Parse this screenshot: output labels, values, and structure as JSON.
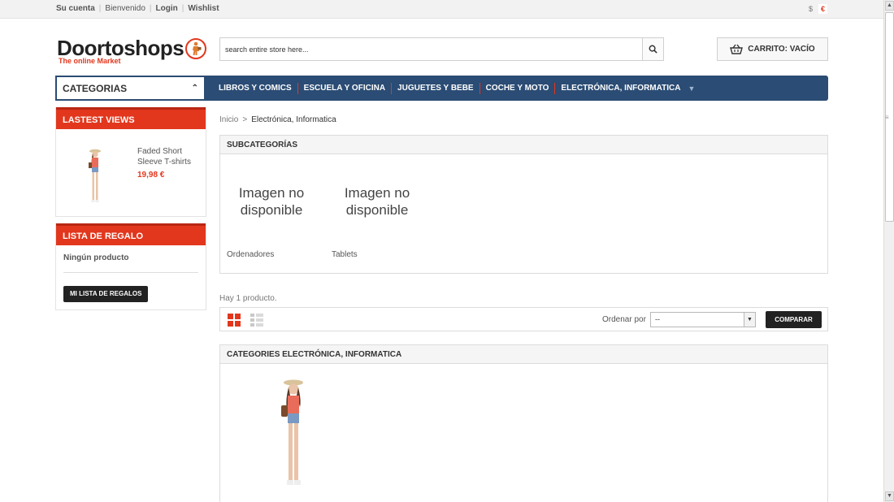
{
  "topbar": {
    "account": "Su cuenta",
    "welcome": "Bienvenido",
    "login": "Login",
    "wishlist": "Wishlist",
    "currencies": [
      "$",
      "€"
    ]
  },
  "logo": {
    "name": "Doortoshops",
    "tagline": "The online Market"
  },
  "search": {
    "placeholder": "search entire store here..."
  },
  "cart": {
    "label": "CARRITO: VACÍO"
  },
  "nav": {
    "categories_label": "CATEGORIAS",
    "items": [
      "LIBROS Y COMICS",
      "ESCUELA Y OFICINA",
      "JUGUETES Y BEBE",
      "COCHE Y MOTO",
      "ELECTRÓNICA, INFORMATICA"
    ]
  },
  "latest_views": {
    "title": "LASTEST VIEWS",
    "product_name": "Faded Short Sleeve T-shirts",
    "product_price": "19,98 €"
  },
  "gift_list": {
    "title": "LISTA DE REGALO",
    "empty": "Ningún producto",
    "button": "MI LISTA DE REGALOS"
  },
  "breadcrumb": {
    "home": "Inicio",
    "sep": ">",
    "current": "Electrónica, Informatica"
  },
  "subcategories": {
    "title": "SUBCATEGORÍAS",
    "items": [
      {
        "image_text": "Imagen no disponible",
        "name": "Ordenadores"
      },
      {
        "image_text": "Imagen no disponible",
        "name": "Tablets"
      }
    ]
  },
  "listing": {
    "count": "Hay 1 producto.",
    "sort_label": "Ordenar por",
    "sort_value": "--",
    "compare": "COMPARAR"
  },
  "category_panel": {
    "title": "CATEGORIES ELECTRÓNICA, INFORMATICA"
  },
  "colors": {
    "accent": "#e2371d",
    "nav": "#2b4c74"
  }
}
